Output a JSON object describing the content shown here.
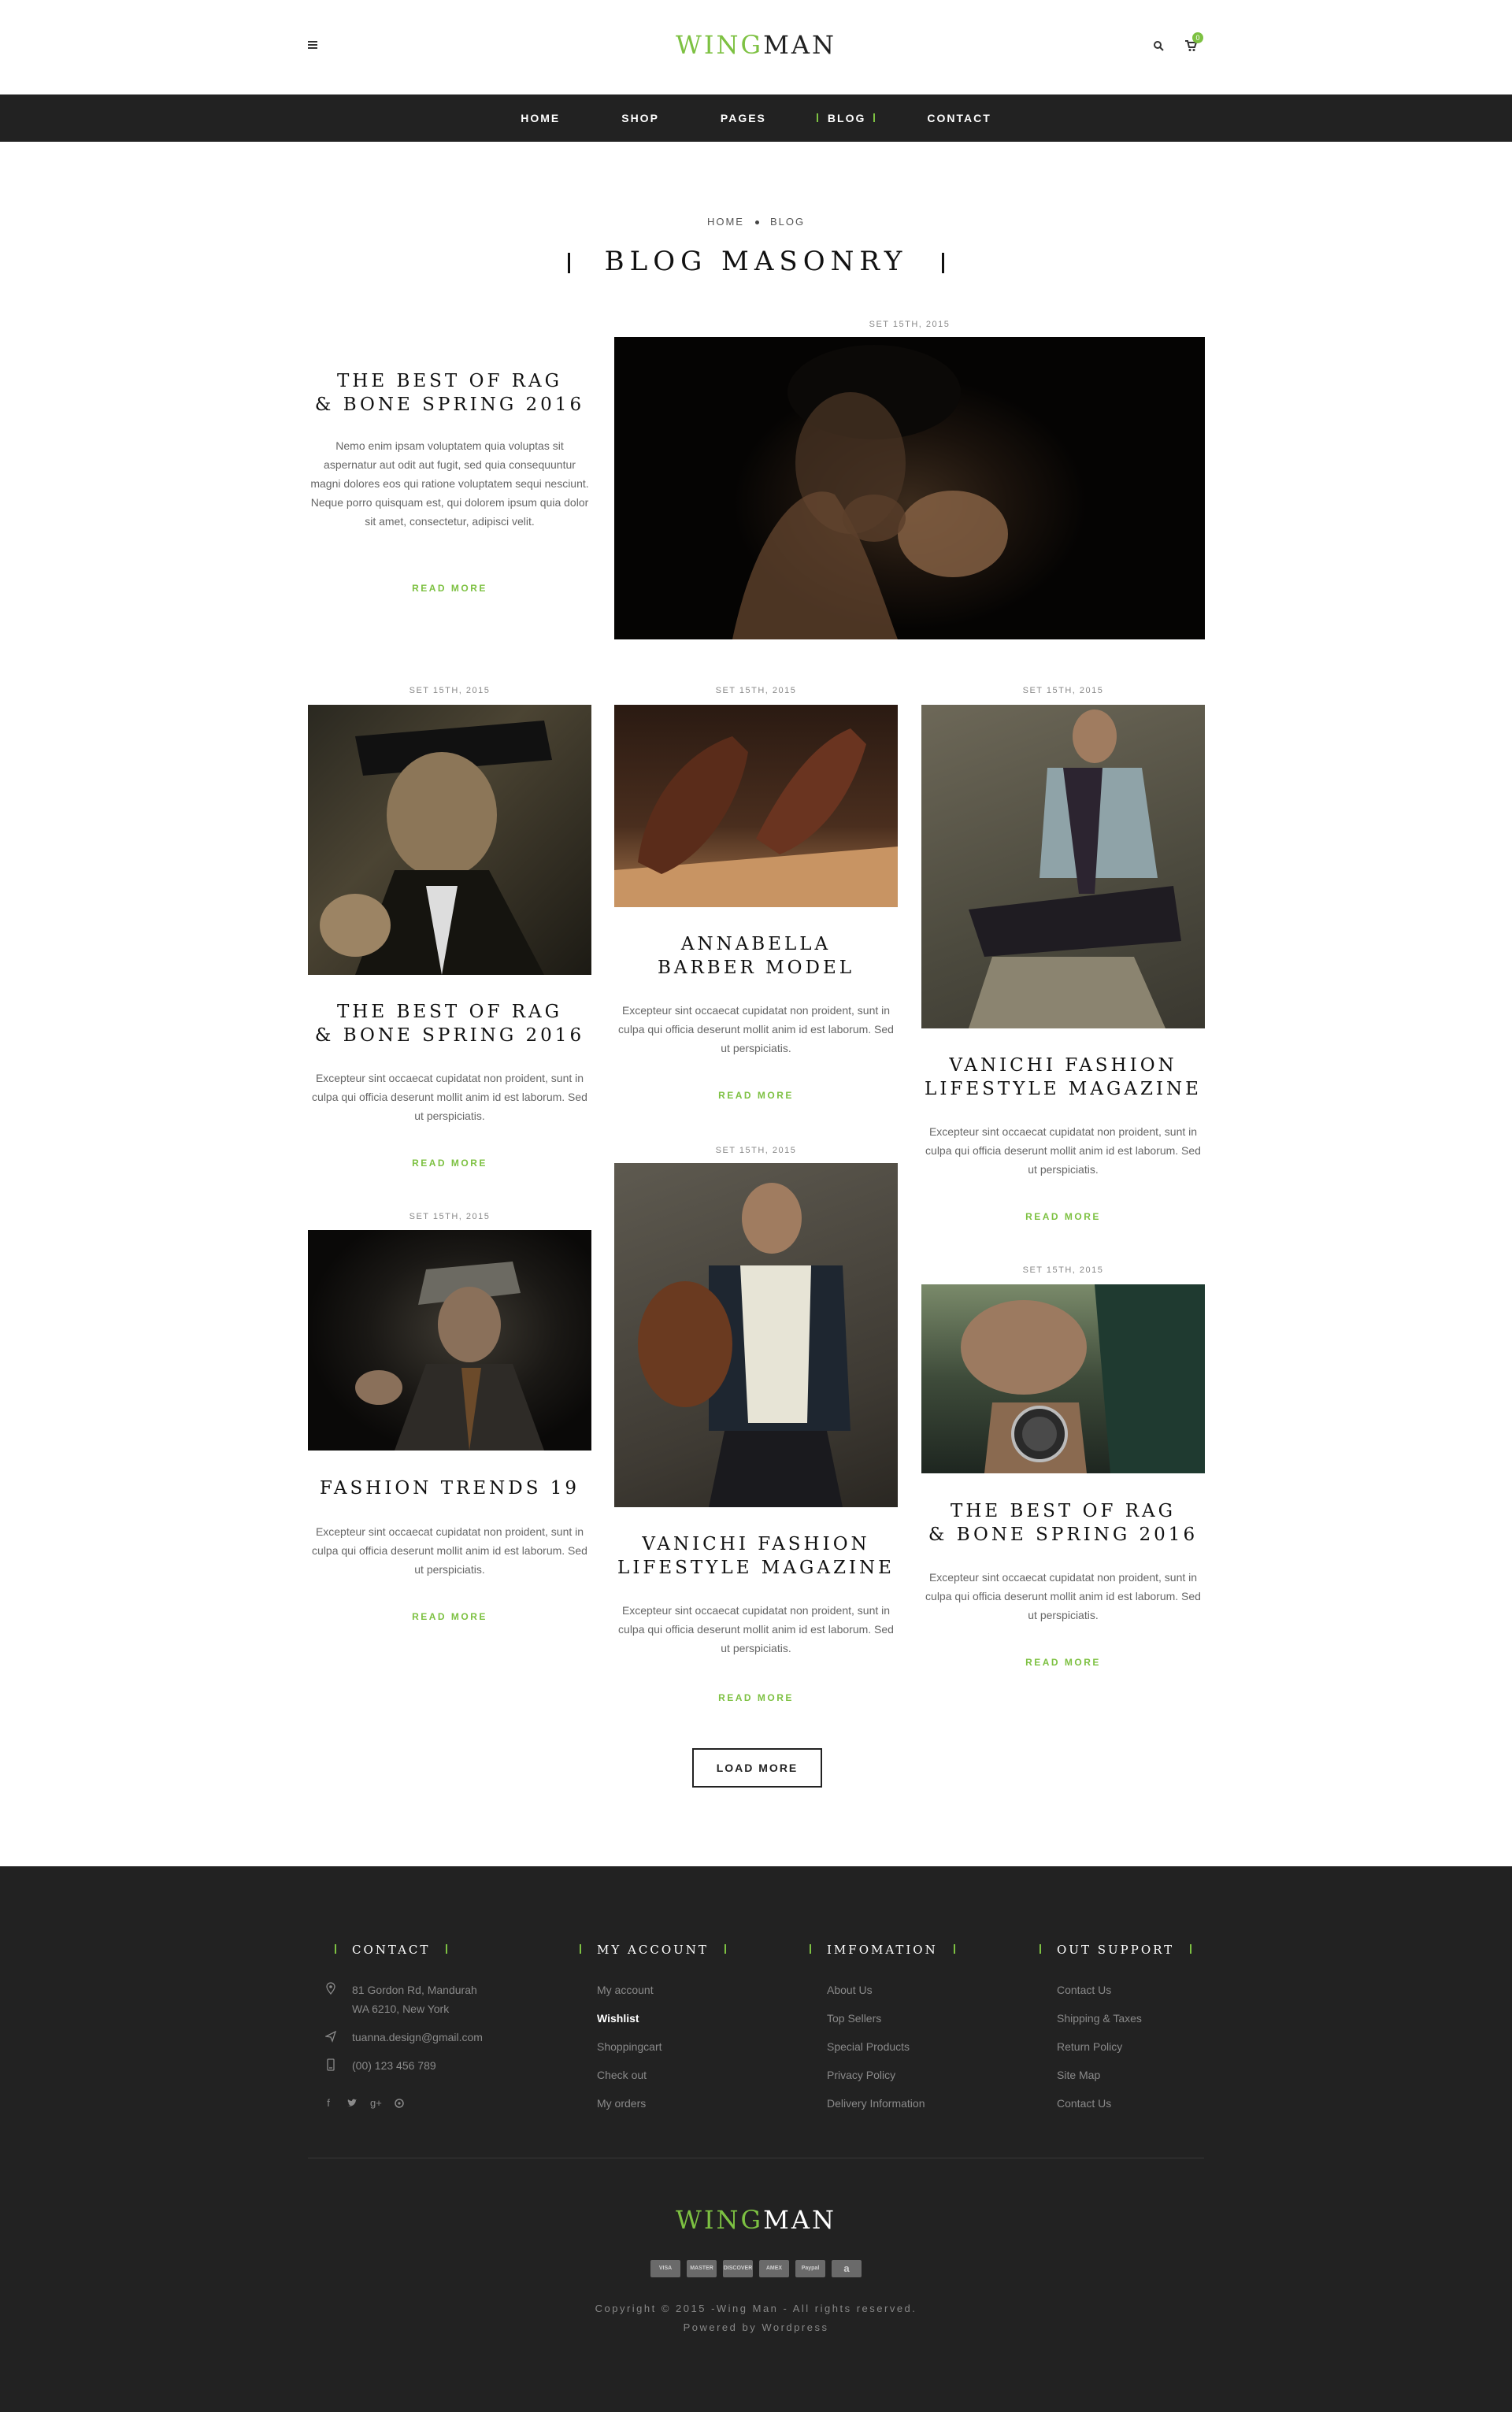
{
  "header": {
    "logo_part1": "WING",
    "logo_part2": "MAN",
    "cart_count": "0",
    "nav": [
      "HOME",
      "SHOP",
      "PAGES",
      "BLOG",
      "CONTACT"
    ],
    "active_nav": "BLOG"
  },
  "breadcrumb": {
    "home": "HOME",
    "current": "BLOG"
  },
  "page_title": "BLOG MASONRY",
  "posts": [
    {
      "date": "SET 15TH, 2015",
      "title_line1": "THE BEST OF RAG",
      "title_line2": "& BONE SPRING 2016",
      "excerpt": "Nemo enim ipsam voluptatem quia voluptas sit aspernatur aut odit aut fugit, sed quia consequuntur magni dolores eos qui ratione voluptatem sequi nesciunt. Neque porro quisquam est, qui dolorem ipsum quia dolor sit amet, consectetur, adipisci velit.",
      "read_more": "READ MORE"
    },
    {
      "date": "SET 15TH, 2015",
      "title_line1": "THE BEST OF RAG",
      "title_line2": "& BONE SPRING 2016",
      "excerpt": "Excepteur sint occaecat cupidatat non proident, sunt in culpa qui officia deserunt mollit anim id est laborum. Sed ut perspiciatis.",
      "read_more": "READ MORE"
    },
    {
      "date": "SET 15TH, 2015",
      "title_line1": "ANNABELLA",
      "title_line2": "BARBER MODEL",
      "excerpt": "Excepteur sint occaecat cupidatat non proident, sunt in culpa qui officia deserunt mollit anim id est laborum. Sed ut perspiciatis.",
      "read_more": "READ MORE"
    },
    {
      "date": "SET 15TH, 2015",
      "title_line1": "VANICHI FASHION",
      "title_line2": "LIFESTYLE MAGAZINE",
      "excerpt": "Excepteur sint occaecat cupidatat non proident, sunt in culpa qui officia deserunt mollit anim id est laborum. Sed ut perspiciatis.",
      "read_more": "READ MORE"
    },
    {
      "date": "SET 15TH, 2015",
      "title_line1": "FASHION TRENDS 19",
      "title_line2": "",
      "excerpt": "Excepteur sint occaecat cupidatat non proident, sunt in culpa qui officia deserunt mollit anim id est laborum. Sed ut perspiciatis.",
      "read_more": "READ MORE"
    },
    {
      "date": "SET 15TH, 2015",
      "title_line1": "VANICHI FASHION",
      "title_line2": "LIFESTYLE MAGAZINE",
      "excerpt": "Excepteur sint occaecat cupidatat non proident, sunt in culpa qui officia deserunt mollit anim id est laborum. Sed ut perspiciatis.",
      "read_more": "READ MORE"
    },
    {
      "date": "SET 15TH, 2015",
      "title_line1": "THE BEST OF RAG",
      "title_line2": "& BONE SPRING 2016",
      "excerpt": "Excepteur sint occaecat cupidatat non proident, sunt in culpa qui officia deserunt mollit anim id est laborum. Sed ut perspiciatis.",
      "read_more": "READ MORE"
    }
  ],
  "load_more": "LOAD MORE",
  "footer": {
    "contact": {
      "title": "CONTACT",
      "address_line1": "81 Gordon Rd, Mandurah",
      "address_line2": "WA 6210, New York",
      "email": "tuanna.design@gmail.com",
      "phone": "(00) 123 456 789",
      "social_icons": [
        "facebook-icon",
        "twitter-icon",
        "google-plus-icon",
        "pinterest-icon"
      ]
    },
    "my_account": {
      "title": "MY ACCOUNT",
      "links": [
        "My account",
        "Wishlist",
        "Shoppingcart",
        "Check out",
        "My orders"
      ],
      "highlighted": "Wishlist"
    },
    "information": {
      "title": "IMFOMATION",
      "links": [
        "About Us",
        "Top Sellers",
        "Special Products",
        "Privacy Policy",
        "Delivery Information"
      ]
    },
    "support": {
      "title": "OUT SUPPORT",
      "links": [
        "Contact Us",
        "Shipping & Taxes",
        "Return Policy",
        "Site Map",
        "Contact Us"
      ]
    },
    "logo_part1": "WING",
    "logo_part2": "MAN",
    "payments": [
      "VISA",
      "MASTER CARD",
      "DISCOVER",
      "AMEX",
      "Paypal",
      "a"
    ],
    "copyright": "Copyright © 2015 -Wing Man - All rights reserved.",
    "powered_by": "Powered by Wordpress"
  },
  "colors": {
    "accent": "#7dc142",
    "nav_bg": "#222222",
    "footer_bg": "#222222"
  }
}
